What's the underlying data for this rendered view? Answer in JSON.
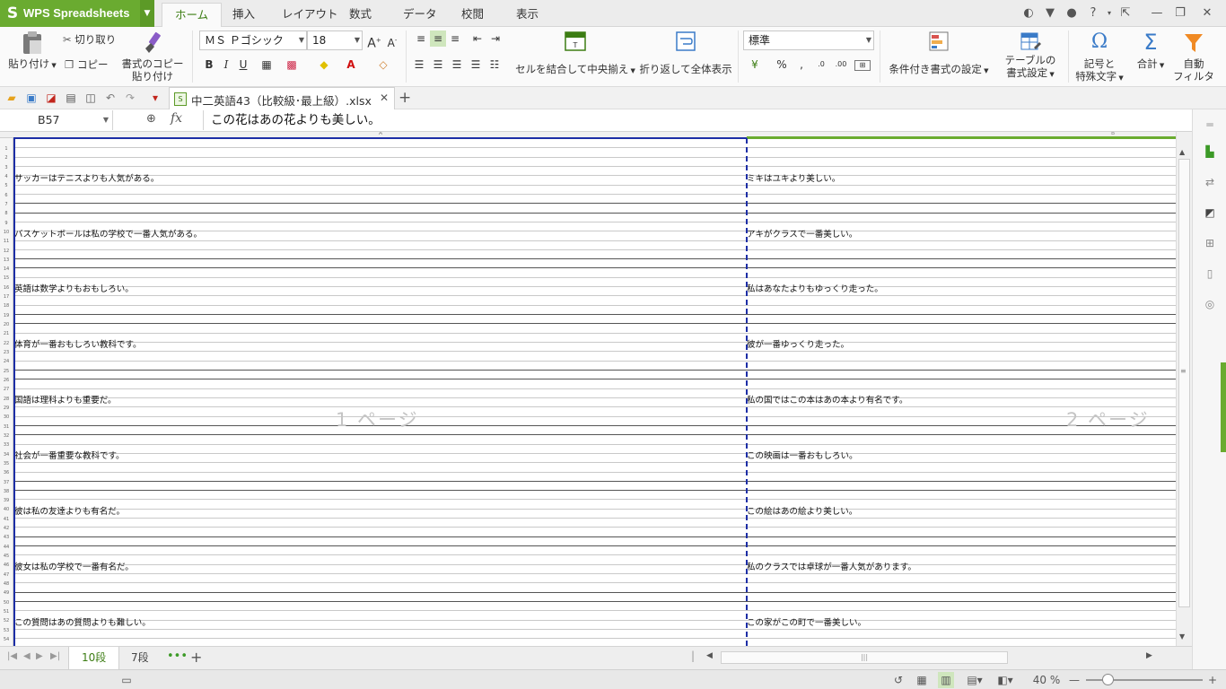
{
  "app": {
    "name": "WPS Spreadsheets",
    "logo": "S"
  },
  "tabs": [
    "ホーム",
    "挿入",
    "レイアウト",
    "数式",
    "データ",
    "校閲",
    "表示"
  ],
  "ribbon": {
    "paste": "貼り付け",
    "cut": "切り取り",
    "copy": "コピー",
    "format_painter_1": "書式のコピー",
    "format_painter_2": "貼り付け",
    "font_name": "ＭＳ Ｐゴシック",
    "font_size": "18",
    "merge_center": "セルを結合して中央揃え",
    "wrap": "折り返して全体表示",
    "number_format": "標準",
    "percent": "%",
    "conditional": "条件付き書式の設定",
    "table_1": "テーブルの",
    "table_2": "書式設定",
    "symbol_1": "記号と",
    "symbol_2": "特殊文字",
    "sum": "合計",
    "filter_1": "自動",
    "filter_2": "フィルタ"
  },
  "document": {
    "tab_title": "中二英語43（比較級･最上級）.xlsx"
  },
  "formula_bar": {
    "cell_ref": "B57",
    "fx": "fx",
    "content": "この花はあの花よりも美しい。"
  },
  "sheet": {
    "page_labels": [
      "1 ページ",
      "2 ページ"
    ],
    "col_a": [
      "サッカーはテニスよりも人気がある。",
      "バスケットボールは私の学校で一番人気がある。",
      "英語は数学よりもおもしろい。",
      "体育が一番おもしろい教科です。",
      "国語は理科よりも重要だ。",
      "社会が一番重要な教科です。",
      "彼は私の友達よりも有名だ。",
      "彼女は私の学校で一番有名だ。",
      "この質問はあの質問よりも難しい。"
    ],
    "col_b": [
      "ミキはユキより美しい。",
      "アキがクラスで一番美しい。",
      "私はあなたよりもゆっくり走った。",
      "彼が一番ゆっくり走った。",
      "私の国ではこの本はあの本より有名です。",
      "この映画は一番おもしろい。",
      "この絵はあの絵より美しい。",
      "私のクラスでは卓球が一番人気があります。",
      "この家がこの町で一番美しい。"
    ],
    "col_a_header": "A",
    "col_b_header": "B"
  },
  "sheet_tabs": [
    "10段",
    "7段"
  ],
  "status": {
    "zoom": "40 %"
  }
}
